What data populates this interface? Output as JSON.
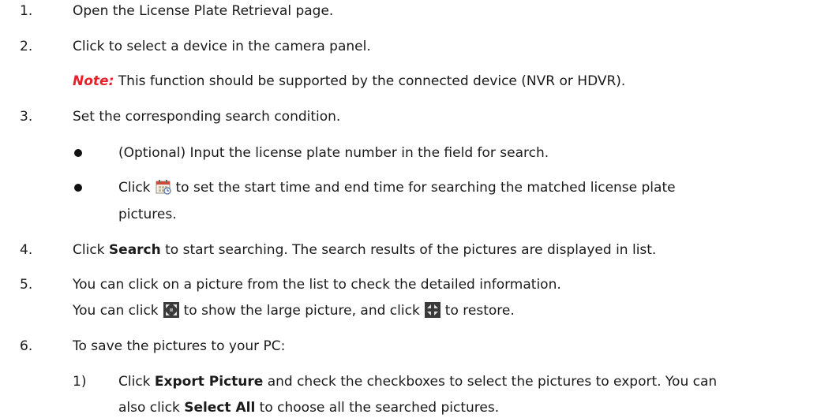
{
  "steps": [
    {
      "num": "1.",
      "text": "Open the License Plate Retrieval page."
    },
    {
      "num": "2.",
      "text": "Click to select a device in the camera panel."
    },
    {
      "num": "3.",
      "text": "Set the corresponding search condition."
    },
    {
      "num": "4.",
      "pre": "Click ",
      "bold": "Search",
      "post": " to start searching. The search results of the pictures are displayed in list."
    },
    {
      "num": "5.",
      "text": "You can click on a picture from the list to check the detailed information."
    },
    {
      "num": "6.",
      "text": "To save the pictures to your PC:"
    }
  ],
  "note": {
    "label": "Note:",
    "text": " This function should be supported by the connected device (NVR or HDVR)."
  },
  "bullets": [
    {
      "text": "(Optional) Input the license plate number in the field for search."
    },
    {
      "pre": "Click",
      "icon": "calendar-icon",
      "post": "to set the start time and end time for searching the matched license plate",
      "cont": "pictures."
    }
  ],
  "step5_extra": {
    "pre": "You can click",
    "icon1": "fullscreen-icon",
    "mid": "to show the large picture, and click",
    "icon2": "restore-icon",
    "post": "to restore."
  },
  "substep": {
    "num": "1)",
    "pre": "Click ",
    "bold1": "Export Picture",
    "mid": " and check the checkboxes to select the pictures to export. You can",
    "line2_pre": "also click ",
    "bold2": "Select All",
    "line2_post": " to choose all the searched pictures."
  }
}
